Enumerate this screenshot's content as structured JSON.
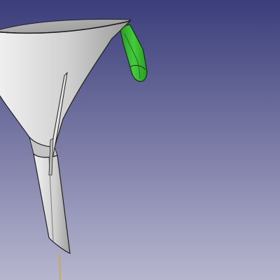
{
  "viewport": {
    "background_top": "#3a3d7a",
    "background_bottom": "#b7b6cf",
    "model": {
      "part": "funnel",
      "funnel_body_color": "#c9c9c9",
      "funnel_shadow_color": "#8d8d8d",
      "edge_color": "#202020",
      "selected_part": "hanging-tab",
      "selected_color": "#35b830",
      "rod_color": "#c9a95a"
    }
  }
}
